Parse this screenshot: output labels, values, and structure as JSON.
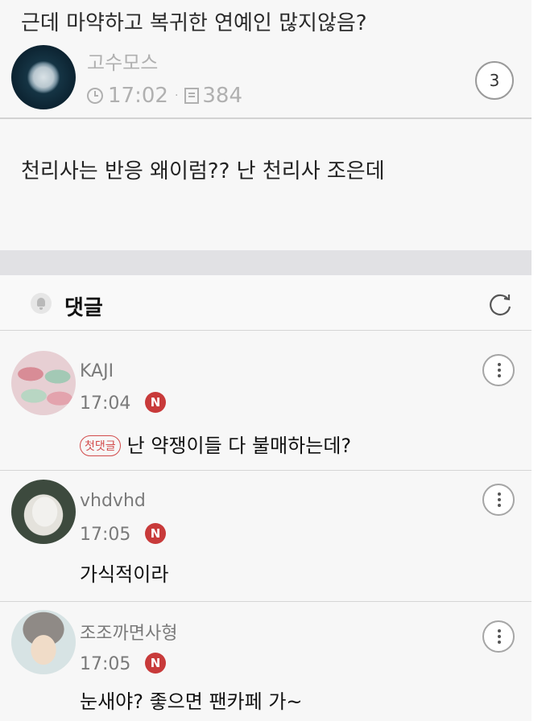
{
  "post": {
    "title": "근데 마약하고 복귀한 연예인 많지않음?",
    "author": "고수모스",
    "time": "17:02",
    "views": "384",
    "comment_count": "3",
    "body": "천리사는 반응 왜이럼?? 난 천리사 조은데"
  },
  "comments_header": {
    "title": "댓글"
  },
  "comments": [
    {
      "author": "KAJI",
      "time": "17:04",
      "badge": "N",
      "first_label": "첫댓글",
      "text": "난 약쟁이들 다 불매하는데?"
    },
    {
      "author": "vhdvhd",
      "time": "17:05",
      "badge": "N",
      "text": "가식적이라"
    },
    {
      "author": "조조까면사형",
      "time": "17:05",
      "badge": "N",
      "text": "눈새야? 좋으면 팬카페 가~"
    }
  ],
  "colors": {
    "new_badge": "#c83a3a",
    "first_comment_badge": "#d24b4b"
  },
  "icons": [
    "clock-icon",
    "document-icon",
    "bell-icon",
    "refresh-icon",
    "more-options-icon"
  ]
}
